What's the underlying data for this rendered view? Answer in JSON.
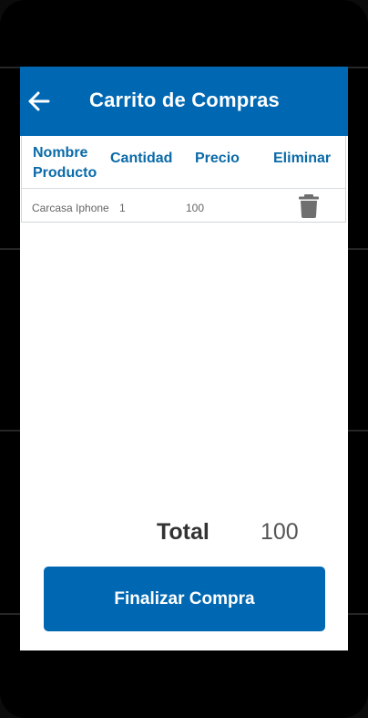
{
  "app_bar": {
    "title": "Carrito de Compras",
    "back_icon": "arrow-left-icon",
    "color": "#0068b3"
  },
  "table": {
    "headers": {
      "name_line1": "Nombre",
      "name_line2": "Producto",
      "quantity": "Cantidad",
      "price": "Precio",
      "delete": "Eliminar"
    },
    "rows": [
      {
        "name": "Carcasa Iphone",
        "quantity": "1",
        "price": "100",
        "delete_icon": "trash-icon"
      }
    ]
  },
  "summary": {
    "total_label": "Total",
    "total_value": "100"
  },
  "actions": {
    "finish_label": "Finalizar Compra"
  }
}
